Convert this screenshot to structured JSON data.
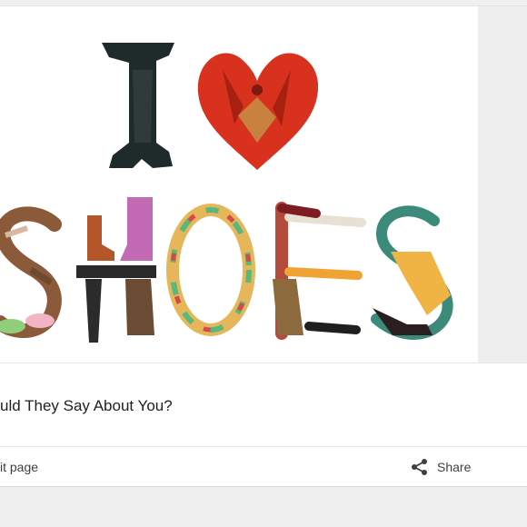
{
  "card": {
    "image_alt": "I ♥ SHOES",
    "title": "uld They Say About You?",
    "actions": {
      "edit_label": "it page",
      "share_label": "Share"
    }
  },
  "icons": {
    "share": "share-icon"
  },
  "colors": {
    "heart_red": "#d8321f",
    "boot_black": "#1f2a2a",
    "text": "#202124",
    "muted_text": "#3c4043"
  }
}
